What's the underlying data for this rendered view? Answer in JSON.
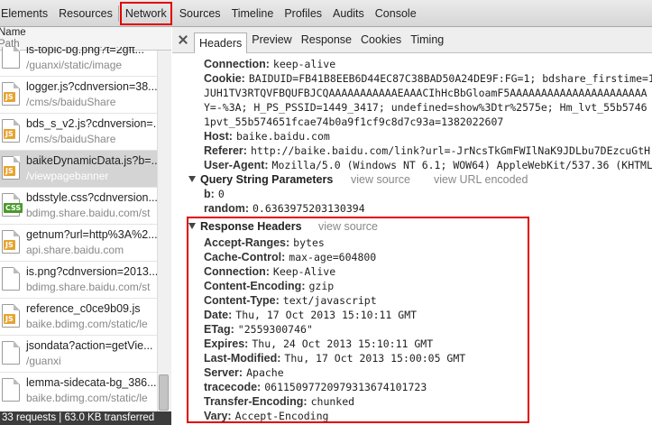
{
  "toolbar": {
    "tabs": [
      "Elements",
      "Resources",
      "Network",
      "Sources",
      "Timeline",
      "Profiles",
      "Audits",
      "Console"
    ],
    "selected": "Network"
  },
  "sidebar": {
    "header_name": "Name",
    "header_path": "Path",
    "requests": [
      {
        "name": "is-topic-bg.png?t=2gft...",
        "path": "/guanxi/static/image",
        "type": "image"
      },
      {
        "name": "logger.js?cdnversion=38...",
        "path": "/cms/s/baiduShare",
        "type": "js"
      },
      {
        "name": "bds_s_v2.js?cdnversion=...",
        "path": "/cms/s/baiduShare",
        "type": "js"
      },
      {
        "name": "baikeDynamicData.js?b=...",
        "path": "/viewpagebanner",
        "type": "js",
        "selected": true
      },
      {
        "name": "bdsstyle.css?cdnversion...",
        "path": "bdimg.share.baidu.com/st",
        "type": "css"
      },
      {
        "name": "getnum?url=http%3A%2...",
        "path": "api.share.baidu.com",
        "type": "js"
      },
      {
        "name": "is.png?cdnversion=2013...",
        "path": "bdimg.share.baidu.com/st",
        "type": "image"
      },
      {
        "name": "reference_c0ce9b09.js",
        "path": "baike.bdimg.com/static/le",
        "type": "js"
      },
      {
        "name": "jsondata?action=getVie...",
        "path": "/guanxi",
        "type": "doc"
      },
      {
        "name": "lemma-sidecata-bg_386...",
        "path": "baike.bdimg.com/static/le",
        "type": "image"
      }
    ],
    "status": "33 requests | 63.0 KB transferred"
  },
  "detail": {
    "tabs": [
      "Headers",
      "Preview",
      "Response",
      "Cookies",
      "Timing"
    ],
    "active_tab": "Headers",
    "request_headers": [
      {
        "key": "Connection:",
        "value": "keep-alive"
      },
      {
        "key": "Cookie:",
        "value": "BAIDUID=FB41B8EEB6D44EC87C38BAD50A24DE9F:FG=1; bdshare_firstime=1",
        "cont": [
          "JUH1TV3RTQVFBQUFBJCQAAAAAAAAAAAEAAACIhHcBbGloamF5AAAAAAAAAAAAAAAAAAAAAA",
          "Y=-%3A; H_PS_PSSID=1449_3417; undefined=show%3Dtr%2575e; Hm_lvt_55b5746",
          "1pvt_55b574651fcae74b0a9f1cf9c8d7c93a=1382022607"
        ]
      },
      {
        "key": "Host:",
        "value": "baike.baidu.com"
      },
      {
        "key": "Referer:",
        "value": "http://baike.baidu.com/link?url=-JrNcsTkGmFWIlNaK9JDLbu7DEzcuGtH"
      },
      {
        "key": "User-Agent:",
        "value": "Mozilla/5.0 (Windows NT 6.1; WOW64) AppleWebKit/537.36 (KHTML"
      }
    ],
    "query_section": {
      "title": "Query String Parameters",
      "link1": "view source",
      "link2": "view URL encoded",
      "params": [
        {
          "key": "b:",
          "value": "0"
        },
        {
          "key": "random:",
          "value": "0.6363975203130394"
        }
      ]
    },
    "response_section": {
      "title": "Response Headers",
      "link": "view source",
      "headers": [
        {
          "key": "Accept-Ranges:",
          "value": "bytes"
        },
        {
          "key": "Cache-Control:",
          "value": "max-age=604800"
        },
        {
          "key": "Connection:",
          "value": "Keep-Alive"
        },
        {
          "key": "Content-Encoding:",
          "value": "gzip"
        },
        {
          "key": "Content-Type:",
          "value": "text/javascript"
        },
        {
          "key": "Date:",
          "value": "Thu, 17 Oct 2013 15:10:11 GMT"
        },
        {
          "key": "ETag:",
          "value": "\"2559300746\""
        },
        {
          "key": "Expires:",
          "value": "Thu, 24 Oct 2013 15:10:11 GMT"
        },
        {
          "key": "Last-Modified:",
          "value": "Thu, 17 Oct 2013 15:00:05 GMT"
        },
        {
          "key": "Server:",
          "value": "Apache"
        },
        {
          "key": "tracecode:",
          "value": "06115097720979313674101723"
        },
        {
          "key": "Transfer-Encoding:",
          "value": "chunked"
        },
        {
          "key": "Vary:",
          "value": "Accept-Encoding"
        }
      ]
    }
  }
}
